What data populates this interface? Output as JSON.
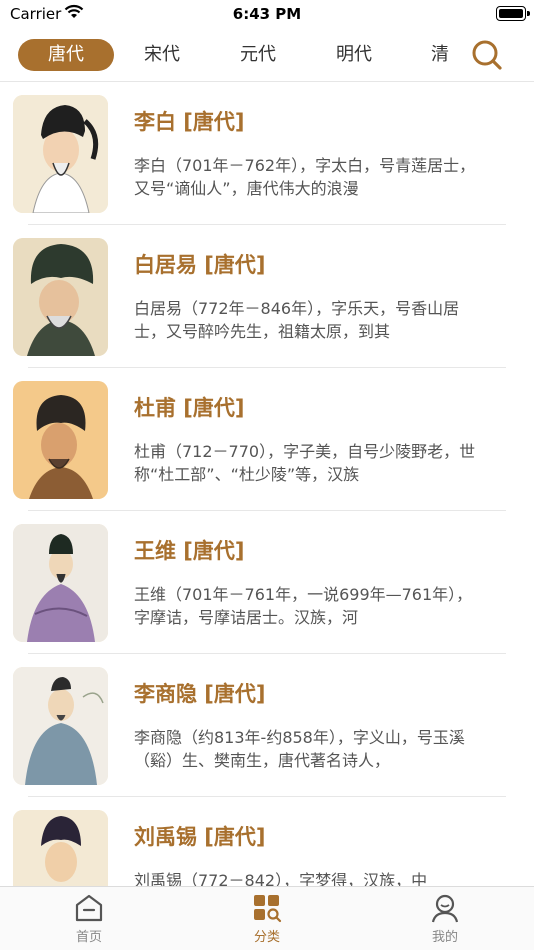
{
  "status_bar": {
    "carrier": "Carrier",
    "time": "6:43 PM"
  },
  "tabs": [
    {
      "label": "唐代",
      "active": true
    },
    {
      "label": "宋代",
      "active": false
    },
    {
      "label": "元代",
      "active": false
    },
    {
      "label": "明代",
      "active": false
    },
    {
      "label": "清",
      "active": false
    }
  ],
  "poets": [
    {
      "name": "李白 [唐代]",
      "desc": "李白（701年－762年），字太白，号青莲居士，又号“谪仙人”，唐代伟大的浪漫"
    },
    {
      "name": "白居易 [唐代]",
      "desc": "白居易（772年－846年），字乐天，号香山居士，又号醉吟先生，祖籍太原，到其"
    },
    {
      "name": "杜甫 [唐代]",
      "desc": "杜甫（712－770），字子美，自号少陵野老，世称“杜工部”、“杜少陵”等，汉族"
    },
    {
      "name": "王维 [唐代]",
      "desc": "王维（701年－761年，一说699年—761年），字摩诘，号摩诘居士。汉族，河"
    },
    {
      "name": "李商隐 [唐代]",
      "desc": "李商隐（约813年-约858年），字义山，号玉溪（谿）生、樊南生，唐代著名诗人，"
    },
    {
      "name": "刘禹锡 [唐代]",
      "desc": "刘禹锡（772－842），字梦得，汉族，中"
    }
  ],
  "tabbar": {
    "home": "首页",
    "category": "分类",
    "mine": "我的"
  },
  "colors": {
    "accent": "#a8702e"
  }
}
